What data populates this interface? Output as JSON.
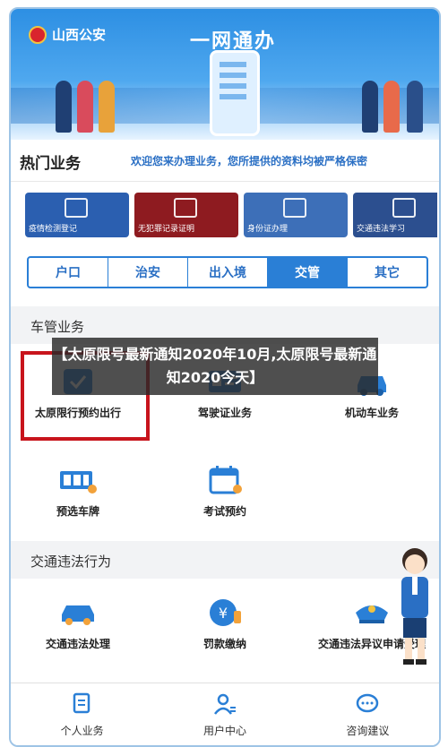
{
  "banner": {
    "logo_text": "山西公安",
    "title": "一网通办"
  },
  "hot": {
    "title": "热门业务",
    "message": "欢迎您来办理业务，您所提供的资料均被严格保密"
  },
  "cards": [
    {
      "label": "疫情检测登记",
      "color": "#2b5fb0"
    },
    {
      "label": "无犯罪记录证明",
      "color": "#8e1b20"
    },
    {
      "label": "身份证办理",
      "color": "#3d6fb8"
    },
    {
      "label": "交通违法学习",
      "color": "#2c4f8f"
    }
  ],
  "tabs": [
    "户口",
    "治安",
    "出入境",
    "交管",
    "其它"
  ],
  "active_tab": "交管",
  "section1": {
    "title": "车管业务",
    "items": [
      "太原限行预约出行",
      "驾驶证业务",
      "机动车业务",
      "预选车牌",
      "考试预约"
    ]
  },
  "section2": {
    "title": "交通违法行为",
    "items": [
      "交通违法处理",
      "罚款缴纳",
      "交通违法异议申请受理"
    ]
  },
  "overlay_text": "【太原限号最新通知2020年10月,太原限号最新通知2020今天】",
  "bottom_nav": [
    "个人业务",
    "用户中心",
    "咨询建议"
  ],
  "colors": {
    "primary": "#2a7fd6",
    "highlight_box": "#c8141c"
  }
}
